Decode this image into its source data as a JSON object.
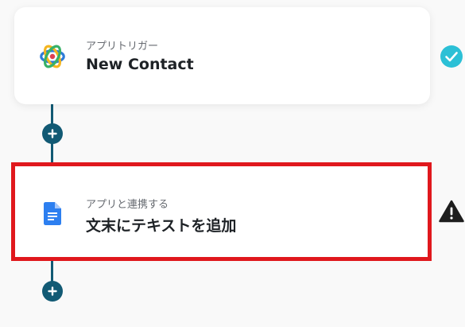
{
  "flow": {
    "trigger": {
      "category": "アプリトリガー",
      "title": "New Contact",
      "app_icon": "atom-logo-icon",
      "status_icon": "check-circle-icon"
    },
    "action": {
      "category": "アプリと連携する",
      "title": "文末にテキストを追加",
      "app_icon": "google-docs-icon",
      "status_icon": "warning-icon"
    },
    "add_step_icon": "plus-icon"
  },
  "colors": {
    "connector": "#125a74",
    "highlight_border": "#e0181d",
    "check_badge": "#2cc0d6",
    "warning": "#1e1e1e",
    "docs_blue": "#2d7ff0"
  }
}
